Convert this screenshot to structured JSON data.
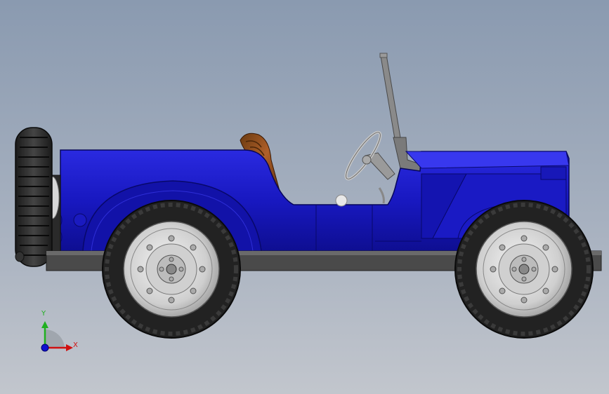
{
  "app": {
    "view": "cad-3d-viewport",
    "model": "jeep-side-view"
  },
  "colors": {
    "background_top": "#8a9ab0",
    "background_bottom": "#c2c6cd",
    "body": "#1a1ac8",
    "body_dark": "#0c0c78",
    "frame": "#4a4a4a",
    "tire": "#262626",
    "rim": "#d8d8d8",
    "seat": "#8b4513",
    "axis_x": "#d01010",
    "axis_y": "#20b020",
    "axis_z": "#1010d0"
  },
  "triad": {
    "x_label": "X",
    "y_label": "Y"
  }
}
